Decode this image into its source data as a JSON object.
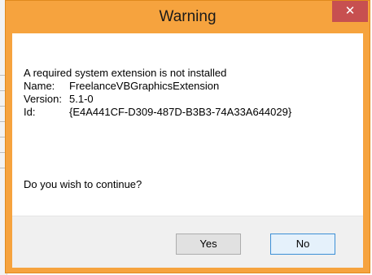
{
  "window": {
    "title": "Warning",
    "close_glyph": "✕"
  },
  "message": {
    "heading": "A required system extension is not installed",
    "fields": [
      {
        "label": "Name:",
        "value": "FreelanceVBGraphicsExtension"
      },
      {
        "label": "Version:",
        "value": "5.1-0"
      },
      {
        "label": "Id:",
        "value": "{E4A441CF-D309-487D-B3B3-74A33A644029}"
      }
    ],
    "question": "Do you wish to continue?"
  },
  "buttons": {
    "yes": "Yes",
    "no": "No"
  },
  "colors": {
    "titlebar": "#f6a33e",
    "close": "#c75050",
    "default_button_border": "#3c8fd6"
  }
}
